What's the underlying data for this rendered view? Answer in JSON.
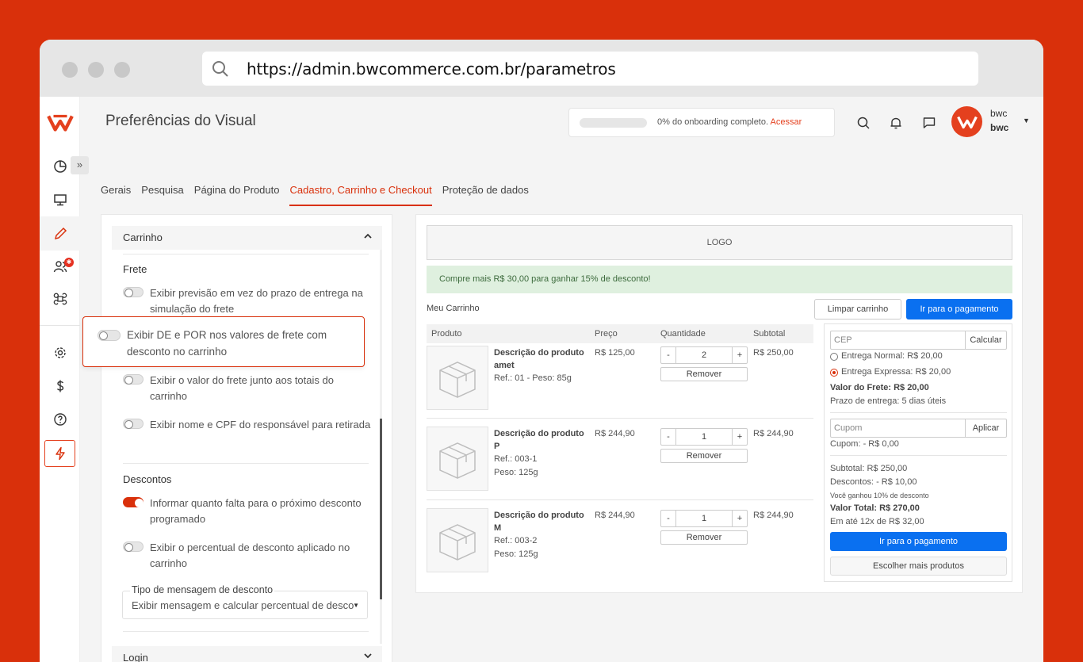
{
  "browser": {
    "url": "https://admin.bwcommerce.com.br/parametros"
  },
  "colors": {
    "brand": "#d9300b",
    "primary_button": "#0a70f0",
    "promo_bg": "#dff0df"
  },
  "sidebar": {
    "icons": [
      "logo-icon",
      "chart-icon",
      "monitor-icon",
      "pencil-icon",
      "users-icon",
      "command-icon",
      "settings-icon",
      "dollar-icon",
      "help-icon",
      "bolt-icon"
    ],
    "badge": "✱"
  },
  "header": {
    "title": "Preferências do Visual",
    "onboarding_text": "0% do onboarding completo.",
    "onboarding_link": "Acessar",
    "onboarding_progress": 0,
    "user_line1": "bwc",
    "user_line2": "bwc"
  },
  "tabs": [
    {
      "label": "Gerais"
    },
    {
      "label": "Pesquisa"
    },
    {
      "label": "Página do Produto"
    },
    {
      "label": "Cadastro, Carrinho e Checkout",
      "active": true
    },
    {
      "label": "Proteção de dados"
    }
  ],
  "settings": {
    "section_title": "Carrinho",
    "frete_title": "Frete",
    "options": [
      {
        "label": "Exibir previsão em vez do prazo de entrega na simulação do frete",
        "on": false
      },
      {
        "label": "Exibir DE e POR nos valores de frete com desconto no carrinho",
        "on": false
      },
      {
        "label": "Exibir o valor do frete junto aos totais do carrinho",
        "on": false
      },
      {
        "label": "Exibir nome e CPF do responsável para retirada",
        "on": false
      },
      {
        "label": "Informar quanto falta para o próximo desconto programado",
        "on": true
      },
      {
        "label": "Exibir o percentual de desconto aplicado no carrinho",
        "on": false
      }
    ],
    "descontos_title": "Descontos",
    "select_label": "Tipo de mensagem de desconto",
    "select_value": "Exibir mensagem e calcular percentual de desconto",
    "next_section": "Login"
  },
  "preview": {
    "logo": "LOGO",
    "promo": "Compre mais R$ 30,00 para ganhar 15% de desconto!",
    "cart_title": "Meu Carrinho",
    "clear_button": "Limpar carrinho",
    "pay_button": "Ir para o pagamento",
    "columns": [
      "Produto",
      "Preço",
      "Quantidade",
      "Subtotal"
    ],
    "items": [
      {
        "name": "Descrição do produto amet",
        "meta1": "Ref.: 01 - Peso: 85g",
        "meta2": "",
        "price": "R$ 125,00",
        "qty": "2",
        "subtotal": "R$ 250,00",
        "minus": "-",
        "plus": "+",
        "remove": "Remover"
      },
      {
        "name": "Descrição do produto P",
        "meta1": "Ref.: 003-1",
        "meta2": "Peso: 125g",
        "price": "R$ 244,90",
        "qty": "1",
        "subtotal": "R$ 244,90",
        "minus": "-",
        "plus": "+",
        "remove": "Remover"
      },
      {
        "name": "Descrição do produto M",
        "meta1": "Ref.: 003-2",
        "meta2": "Peso: 125g",
        "price": "R$ 244,90",
        "qty": "1",
        "subtotal": "R$ 244,90",
        "minus": "-",
        "plus": "+",
        "remove": "Remover"
      }
    ],
    "summary": {
      "cep_placeholder": "CEP",
      "cep_button": "Calcular",
      "ship1": "Entrega Normal: R$ 20,00",
      "ship2": "Entrega Expressa: R$ 20,00",
      "ship_selected": 2,
      "freight_value": "Valor do Frete: R$ 20,00",
      "delivery": "Prazo de entrega: 5 dias úteis",
      "coupon_placeholder": "Cupom",
      "coupon_button": "Aplicar",
      "coupon_line": "Cupom: - R$ 0,00",
      "subtotal": "Subtotal: R$ 250,00",
      "discounts": "Descontos: - R$ 10,00",
      "discount_note": "Você ganhou 10% de desconto",
      "total": "Valor Total: R$ 270,00",
      "installments": "Em até 12x de R$ 32,00",
      "pay_button": "Ir para o pagamento",
      "more_button": "Escolher mais produtos"
    }
  }
}
